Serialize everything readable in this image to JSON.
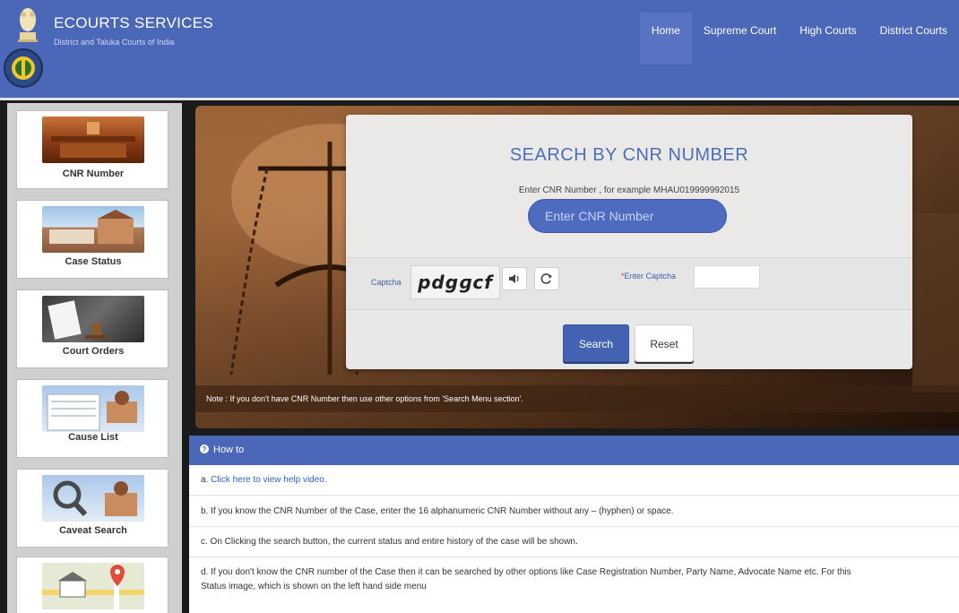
{
  "header": {
    "title": "ECOURTS SERVICES",
    "subtitle": "District and Taluka Courts of India",
    "nav": [
      "Home",
      "Supreme Court",
      "High Courts",
      "District Courts"
    ]
  },
  "sidebar": {
    "items": [
      {
        "label": "CNR Number",
        "icon": "courtroom-image"
      },
      {
        "label": "Case Status",
        "icon": "court-building-image"
      },
      {
        "label": "Court Orders",
        "icon": "document-handover-image"
      },
      {
        "label": "Cause List",
        "icon": "cause-list-image"
      },
      {
        "label": "Caveat Search",
        "icon": "magnifier-image"
      },
      {
        "label": "",
        "icon": "map-pin-image"
      }
    ]
  },
  "search": {
    "title": "SEARCH BY CNR NUMBER",
    "hint": "Enter CNR Number , for example MHAU019999992015",
    "cnr_placeholder": "Enter CNR Number",
    "captcha_label": "Captcha",
    "captcha_text": "pdgɡcf",
    "enter_captcha_label": "Enter Captcha",
    "search_button": "Search",
    "reset_button": "Reset"
  },
  "note": "Note : If you don't have CNR Number then use other options from 'Search Menu section'.",
  "howto": {
    "heading": "How to",
    "items": [
      {
        "prefix": "a. ",
        "link": "Click here to view help video."
      },
      {
        "text": "b. If you know the CNR Number of the Case, enter the 16 alphanumeric CNR Number without any – (hyphen) or space."
      },
      {
        "text": "c. On Clicking the search button, the current status and entire history of the case will be shown."
      },
      {
        "text": "d. If you don't know the CNR number of the Case then it can be searched by other options like Case Registration Number, Party Name, Advocate Name etc. For this",
        "text2": "Status image, which is shown on the left hand side menu"
      }
    ]
  },
  "colors": {
    "brand_blue": "#4a67b8",
    "title_blue": "#4a6fb8",
    "link_blue": "#2f62c4"
  }
}
